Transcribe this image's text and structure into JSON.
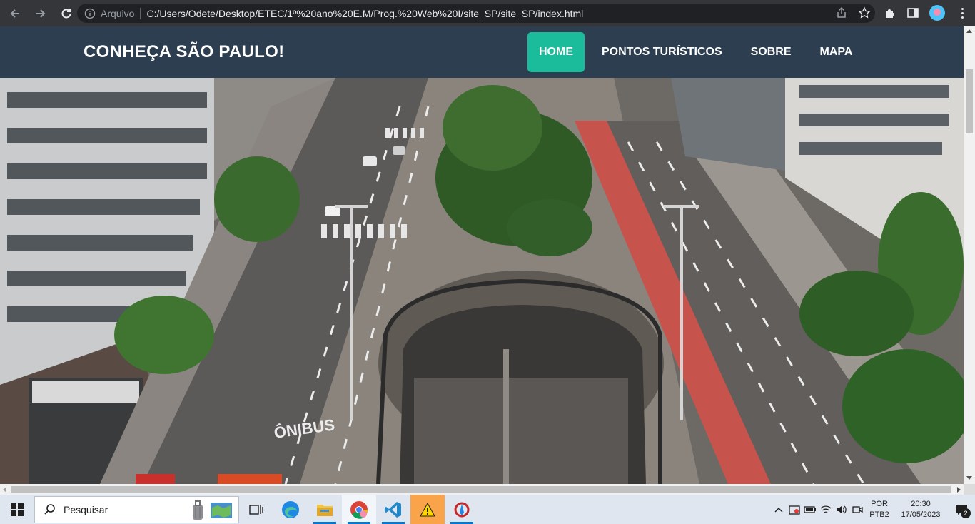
{
  "browser": {
    "protocol_label": "Arquivo",
    "url": "C:/Users/Odete/Desktop/ETEC/1º%20ano%20E.M/Prog.%20Web%20I/site_SP/site_SP/index.html"
  },
  "site": {
    "brand": "CONHEÇA SÃO PAULO!",
    "menu": [
      {
        "label": "HOME",
        "active": true
      },
      {
        "label": "PONTOS TURÍSTICOS",
        "active": false
      },
      {
        "label": "SOBRE",
        "active": false
      },
      {
        "label": "MAPA",
        "active": false
      }
    ],
    "colors": {
      "header_bg": "#2c3e50",
      "accent": "#1abc9c"
    },
    "hero": {
      "street_text": "ÔNIBUS"
    }
  },
  "taskbar": {
    "search_placeholder": "Pesquisar",
    "language": {
      "line1": "POR",
      "line2": "PTB2"
    },
    "clock": {
      "time": "20:30",
      "date": "17/05/2023"
    },
    "notification_count": "2"
  }
}
